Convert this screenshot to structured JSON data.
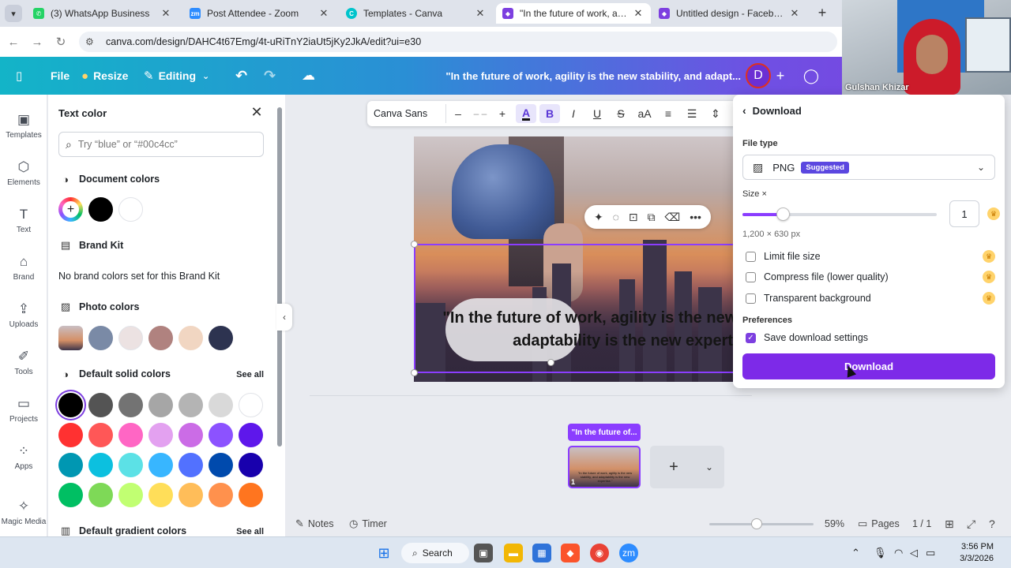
{
  "browser": {
    "tabs": [
      {
        "title": "(3) WhatsApp Business",
        "icon": "whatsapp-icon",
        "color": "#25d366",
        "active": false
      },
      {
        "title": "Post Attendee - Zoom",
        "icon": "zoom-icon",
        "color": "#2d8cff",
        "active": false
      },
      {
        "title": "Templates - Canva",
        "icon": "canva-icon",
        "color": "#00c4cc",
        "active": false
      },
      {
        "title": "\"In the future of work, agility is",
        "icon": "canva-shield-icon",
        "color": "#7d3fe0",
        "active": true
      },
      {
        "title": "Untitled design - Facebook Pos",
        "icon": "canva-shield-icon",
        "color": "#7d3fe0",
        "active": false
      }
    ],
    "url": "canva.com/design/DAHC4t67Emg/4t-uRiTnY2iaUt5jKy2JkA/edit?ui=e30"
  },
  "webcam": {
    "name": "Gulshan Khizar"
  },
  "topbar": {
    "file": "File",
    "resize": "Resize",
    "editing": "Editing",
    "design_title": "\"In the future of work, agility is the new stability, and adapt...",
    "avatar": "D"
  },
  "rail": [
    {
      "label": "Templates",
      "icon": "templates-icon"
    },
    {
      "label": "Elements",
      "icon": "elements-icon"
    },
    {
      "label": "Text",
      "icon": "text-icon"
    },
    {
      "label": "Brand",
      "icon": "brand-icon"
    },
    {
      "label": "Uploads",
      "icon": "uploads-icon"
    },
    {
      "label": "Tools",
      "icon": "tools-icon"
    },
    {
      "label": "Projects",
      "icon": "projects-icon"
    },
    {
      "label": "Apps",
      "icon": "apps-icon"
    },
    {
      "label": "Magic Media",
      "icon": "magic-media-icon"
    }
  ],
  "panel": {
    "title": "Text color",
    "search_placeholder": "Try “blue” or “#00c4cc”",
    "document_colors": "Document colors",
    "brand_kit": "Brand Kit",
    "brand_kit_text": "No brand colors set for this Brand Kit",
    "photo_colors": "Photo colors",
    "default_solid": "Default solid colors",
    "default_gradient": "Default gradient colors",
    "see_all": "See all",
    "doc_swatches": [
      "#000000",
      "#ffffff"
    ],
    "photo_swatches": [
      "#7a8aa6",
      "#ece2e2",
      "#b0827f",
      "#f1d6c2",
      "#2d3350"
    ],
    "solid_swatches": [
      "#000000",
      "#545454",
      "#737373",
      "#a6a6a6",
      "#b4b4b4",
      "#d9d9d9",
      "#ffffff",
      "#ff3131",
      "#ff5757",
      "#ff66c4",
      "#e3a1f0",
      "#cb6ce6",
      "#8c52ff",
      "#5e17eb",
      "#0097b2",
      "#0cc0df",
      "#5ce1e6",
      "#38b6ff",
      "#5271ff",
      "#004aad",
      "#1800ad",
      "#00bf63",
      "#7ed957",
      "#c1ff72",
      "#ffde59",
      "#ffbd59",
      "#ff914d",
      "#ff751f"
    ]
  },
  "toolbar": {
    "font": "Canva Sans",
    "minus": "–",
    "size": "– –",
    "plus": "+",
    "text_color": "A",
    "bold": "B",
    "italic": "I",
    "underline": "U",
    "strike": "S",
    "case": "aA"
  },
  "design": {
    "quote": "\"In the future of work, agility is the new stability, and adaptability is the new expertise.\""
  },
  "pages": {
    "label": "\"In the future of...",
    "thumb_number": "1"
  },
  "bottombar": {
    "notes": "Notes",
    "timer": "Timer",
    "zoom": "59%",
    "pages": "Pages",
    "page_count": "1 / 1",
    "zoom_level": 0.4
  },
  "download": {
    "back": "Download",
    "file_type_label": "File type",
    "file_type": "PNG",
    "suggested": "Suggested",
    "size_label": "Size ×",
    "size_value": "1",
    "size_fraction": 0.2,
    "dimensions": "1,200 × 630 px",
    "options": [
      {
        "label": "Limit file size",
        "checked": false,
        "pro": true
      },
      {
        "label": "Compress file (lower quality)",
        "checked": false,
        "pro": true
      },
      {
        "label": "Transparent background",
        "checked": false,
        "pro": true
      }
    ],
    "preferences_label": "Preferences",
    "save_settings": "Save download settings",
    "save_settings_checked": true,
    "button": "Download"
  },
  "taskbar": {
    "search": "Search",
    "time": "3:56 PM",
    "date": "3/3/2026"
  },
  "colors": {
    "accent": "#7d2ae8",
    "selection": "#8b3dff",
    "badge": "#5b47e0"
  }
}
